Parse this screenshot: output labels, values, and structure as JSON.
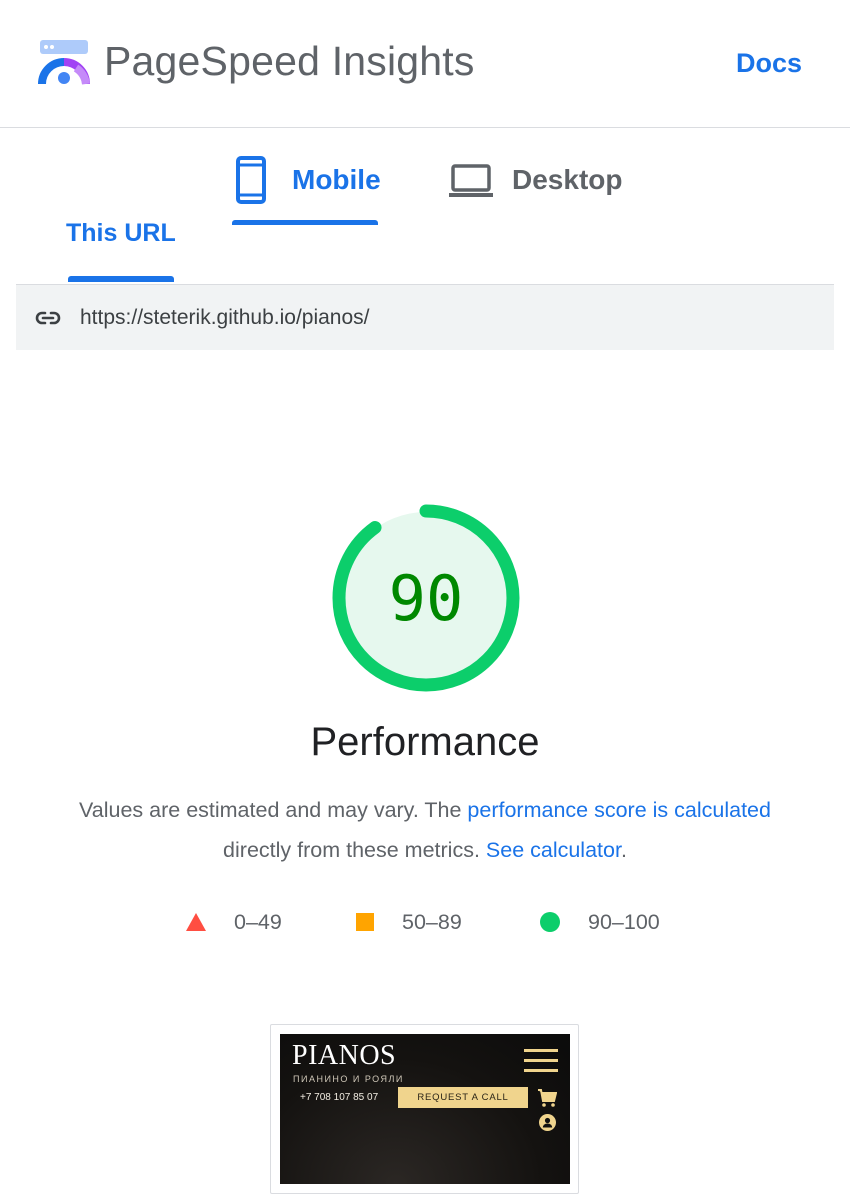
{
  "header": {
    "app_title": "PageSpeed Insights",
    "logo_icon": "pagespeed-logo-icon",
    "docs_label": "Docs"
  },
  "device_tabs": [
    {
      "label": "Mobile",
      "icon": "smartphone-icon",
      "selected": true
    },
    {
      "label": "Desktop",
      "icon": "laptop-icon",
      "selected": false
    }
  ],
  "source_tab": {
    "label": "This URL",
    "selected": true
  },
  "url_bar": {
    "icon": "link-icon",
    "url": "https://steterik.github.io/pianos/"
  },
  "score": {
    "value": "90",
    "fraction": 0.9,
    "category": "Performance",
    "color_ring": "#0cce6b",
    "color_text": "#008800",
    "color_fill": "#e6f8ee"
  },
  "description": {
    "text_before": "Values are estimated and may vary. The ",
    "link1": "performance score is calculated",
    "text_middle": " directly from these metrics. ",
    "link2": "See calculator",
    "text_after": "."
  },
  "legend": [
    {
      "range": "0–49",
      "shape": "triangle",
      "color": "#ff4e42"
    },
    {
      "range": "50–89",
      "shape": "square",
      "color": "#ffa400"
    },
    {
      "range": "90–100",
      "shape": "circle",
      "color": "#0cce6b"
    }
  ],
  "screenshot": {
    "brand": "PIANOS",
    "tagline": "ПИАНИНО И РОЯЛИ",
    "phone": "+7 708 107 85 07",
    "cta": "REQUEST A CALL"
  }
}
